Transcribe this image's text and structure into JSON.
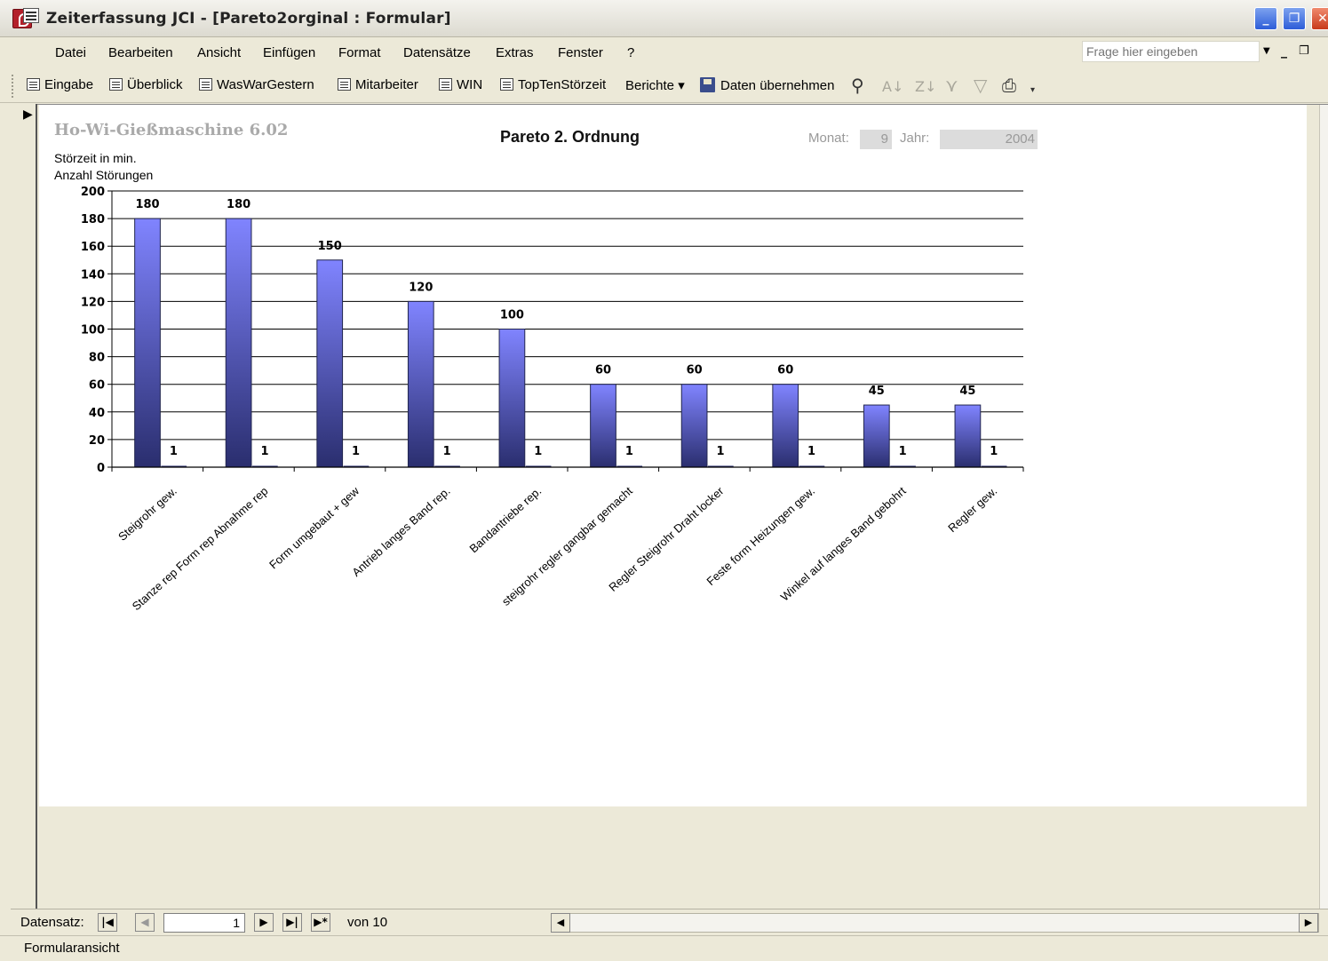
{
  "window": {
    "title": "Zeiterfassung JCI - [Pareto2orginal : Formular]"
  },
  "menu": {
    "items": [
      "Datei",
      "Bearbeiten",
      "Ansicht",
      "Einfügen",
      "Format",
      "Datensätze",
      "Extras",
      "Fenster",
      "?"
    ],
    "help_placeholder": "Frage hier eingeben"
  },
  "toolbar": {
    "buttons": [
      "Eingabe",
      "Überblick",
      "WasWarGestern",
      "Mitarbeiter",
      "WIN",
      "TopTenStörzeit"
    ],
    "reports_label": "Berichte ▾",
    "import_label": "Daten übernehmen"
  },
  "form": {
    "machine_title": "Ho-Wi-Gießmaschine 6.02",
    "chart_title": "Pareto 2. Ordnung",
    "month_label": "Monat:",
    "month_value": "9",
    "year_label": "Jahr:",
    "year_value": "2004",
    "ylabel_line1": "Störzeit in min.",
    "ylabel_line2": "Anzahl Störungen"
  },
  "chart_data": {
    "type": "bar",
    "title": "Pareto 2. Ordnung",
    "ylabel": "Störzeit in min. / Anzahl Störungen",
    "ylim": [
      0,
      200
    ],
    "yticks": [
      0,
      20,
      40,
      60,
      80,
      100,
      120,
      140,
      160,
      180,
      200
    ],
    "categories": [
      "Steigrohr gew.",
      "Stanze rep Form rep Abnahme rep",
      "Form umgebaut + gew",
      "Antrieb langes Band rep.",
      "Bandantriebe rep.",
      "steigrohr regler gangbar gemacht",
      "Regler Steigrohr Draht locker",
      "Feste form Heizungen gew.",
      "Winkel auf langes Band gebohrt",
      "Regler gew."
    ],
    "series": [
      {
        "values": [
          180,
          180,
          150,
          120,
          100,
          60,
          60,
          60,
          45,
          45
        ],
        "color": "#6f73ee"
      },
      {
        "values": [
          1,
          1,
          1,
          1,
          1,
          1,
          1,
          1,
          1,
          1
        ],
        "color": "#2a2e6e"
      }
    ],
    "grid": true
  },
  "nav": {
    "label": "Datensatz:",
    "current": "1",
    "of_text": "von  10"
  },
  "status": {
    "text": "Formularansicht"
  }
}
